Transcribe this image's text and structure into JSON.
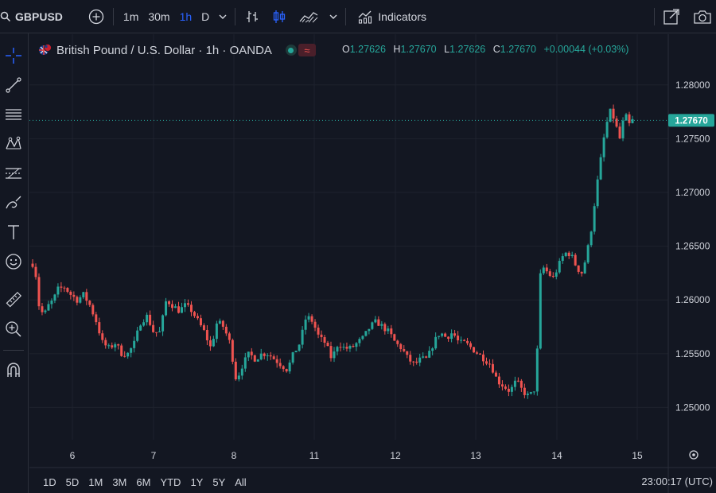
{
  "header": {
    "symbol": "GBPUSD",
    "intervals": [
      "1m",
      "30m",
      "1h",
      "D"
    ],
    "active_interval": "1h",
    "indicators_label": "Indicators"
  },
  "legend": {
    "title": "British Pound / U.S. Dollar · 1h · OANDA",
    "open_key": "O",
    "open": "1.27626",
    "high_key": "H",
    "high": "1.27670",
    "low_key": "L",
    "low": "1.27626",
    "close_key": "C",
    "close": "1.27670",
    "change": "+0.00044 (+0.03%)"
  },
  "price_axis": {
    "ticks": [
      "1.28000",
      "1.27500",
      "1.27000",
      "1.26500",
      "1.26000",
      "1.25500",
      "1.25000"
    ],
    "last_price": "1.27670"
  },
  "time_axis": {
    "ticks": [
      "6",
      "7",
      "8",
      "11",
      "12",
      "13",
      "14",
      "15"
    ]
  },
  "ranges": [
    "1D",
    "5D",
    "1M",
    "3M",
    "6M",
    "YTD",
    "1Y",
    "5Y",
    "All"
  ],
  "clock": "23:00:17 (UTC)",
  "colors": {
    "up": "#26a69a",
    "down": "#ef5350",
    "background": "#131722",
    "grid": "#1e222d",
    "accent": "#2962ff"
  },
  "left_toolbar_icons": [
    "crosshair-icon",
    "trend-line-icon",
    "horizontal-lines-icon",
    "pattern-icon",
    "fib-icon",
    "brush-icon",
    "text-icon",
    "emoji-icon",
    "ruler-icon",
    "zoom-in-icon",
    "magnet-icon"
  ],
  "chart_data": {
    "type": "candlestick",
    "symbol": "GBPUSD",
    "timeframe": "1h",
    "ylim": [
      1.247,
      1.2825
    ],
    "x_ticks": [
      "6",
      "7",
      "8",
      "11",
      "12",
      "13",
      "14",
      "15"
    ],
    "path": [
      [
        0,
        1.262
      ],
      [
        3,
        1.2635
      ],
      [
        7,
        1.263
      ],
      [
        12,
        1.2595
      ],
      [
        18,
        1.2585
      ],
      [
        24,
        1.2595
      ],
      [
        30,
        1.26
      ],
      [
        36,
        1.261
      ],
      [
        44,
        1.2612
      ],
      [
        52,
        1.2605
      ],
      [
        60,
        1.26
      ],
      [
        68,
        1.2605
      ],
      [
        76,
        1.2595
      ],
      [
        84,
        1.258
      ],
      [
        92,
        1.256
      ],
      [
        100,
        1.2555
      ],
      [
        108,
        1.256
      ],
      [
        116,
        1.255
      ],
      [
        124,
        1.255
      ],
      [
        132,
        1.256
      ],
      [
        140,
        1.258
      ],
      [
        148,
        1.2585
      ],
      [
        156,
        1.257
      ],
      [
        164,
        1.257
      ],
      [
        172,
        1.26
      ],
      [
        180,
        1.2595
      ],
      [
        188,
        1.259
      ],
      [
        196,
        1.2595
      ],
      [
        204,
        1.259
      ],
      [
        212,
        1.258
      ],
      [
        220,
        1.257
      ],
      [
        228,
        1.2555
      ],
      [
        236,
        1.258
      ],
      [
        244,
        1.2575
      ],
      [
        252,
        1.256
      ],
      [
        260,
        1.2525
      ],
      [
        268,
        1.254
      ],
      [
        276,
        1.255
      ],
      [
        284,
        1.2545
      ],
      [
        292,
        1.255
      ],
      [
        300,
        1.255
      ],
      [
        308,
        1.2545
      ],
      [
        316,
        1.254
      ],
      [
        324,
        1.2535
      ],
      [
        332,
        1.255
      ],
      [
        340,
        1.256
      ],
      [
        348,
        1.2585
      ],
      [
        356,
        1.258
      ],
      [
        364,
        1.2565
      ],
      [
        372,
        1.256
      ],
      [
        380,
        1.2545
      ],
      [
        388,
        1.256
      ],
      [
        396,
        1.2555
      ],
      [
        404,
        1.2555
      ],
      [
        412,
        1.256
      ],
      [
        420,
        1.2565
      ],
      [
        428,
        1.2575
      ],
      [
        436,
        1.258
      ],
      [
        444,
        1.2575
      ],
      [
        452,
        1.257
      ],
      [
        460,
        1.256
      ],
      [
        468,
        1.2555
      ],
      [
        476,
        1.2545
      ],
      [
        484,
        1.254
      ],
      [
        492,
        1.2545
      ],
      [
        500,
        1.2545
      ],
      [
        508,
        1.256
      ],
      [
        516,
        1.257
      ],
      [
        524,
        1.2565
      ],
      [
        532,
        1.257
      ],
      [
        540,
        1.256
      ],
      [
        548,
        1.256
      ],
      [
        556,
        1.2555
      ],
      [
        564,
        1.255
      ],
      [
        572,
        1.2545
      ],
      [
        580,
        1.254
      ],
      [
        588,
        1.2525
      ],
      [
        596,
        1.252
      ],
      [
        604,
        1.2515
      ],
      [
        612,
        1.2525
      ],
      [
        620,
        1.2515
      ],
      [
        628,
        1.251
      ],
      [
        633,
        1.2515
      ],
      [
        637,
        1.252
      ],
      [
        641,
        1.262
      ],
      [
        646,
        1.263
      ],
      [
        652,
        1.2625
      ],
      [
        658,
        1.262
      ],
      [
        664,
        1.263
      ],
      [
        670,
        1.264
      ],
      [
        676,
        1.2645
      ],
      [
        682,
        1.264
      ],
      [
        688,
        1.263
      ],
      [
        694,
        1.2625
      ],
      [
        700,
        1.264
      ],
      [
        706,
        1.2665
      ],
      [
        712,
        1.27
      ],
      [
        718,
        1.273
      ],
      [
        724,
        1.276
      ],
      [
        730,
        1.2775
      ],
      [
        734,
        1.277
      ],
      [
        738,
        1.276
      ],
      [
        742,
        1.275
      ],
      [
        746,
        1.2765
      ],
      [
        750,
        1.277
      ],
      [
        754,
        1.2763
      ],
      [
        758,
        1.2767
      ]
    ]
  }
}
